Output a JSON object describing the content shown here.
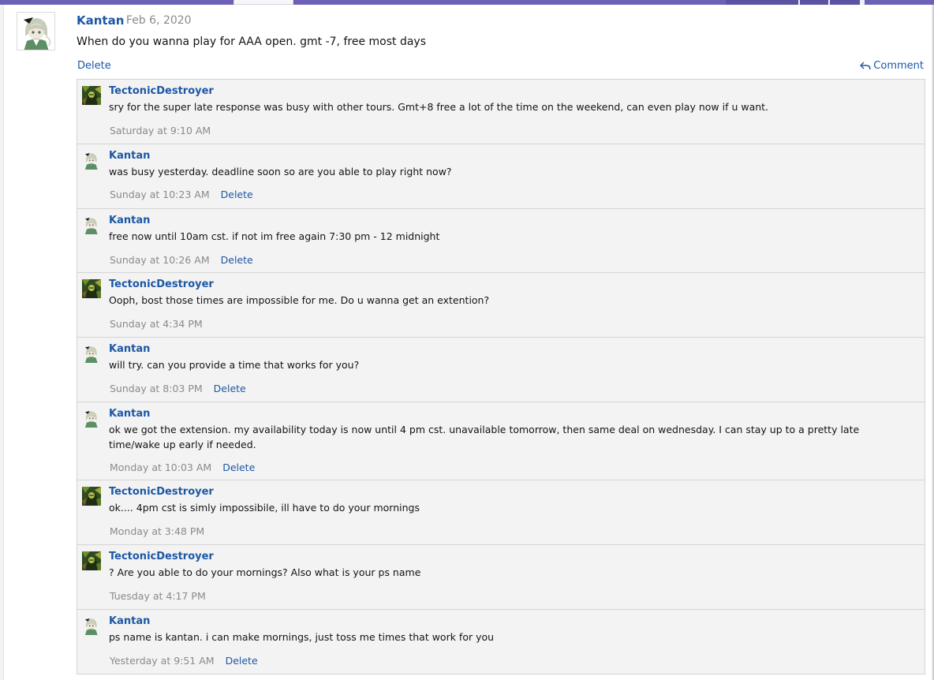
{
  "post": {
    "author": "Kantan",
    "date": "· Feb 6, 2020",
    "text": "When do you wanna play for AAA open. gmt -7, free most days",
    "delete_label": "Delete",
    "comment_label": "Comment",
    "avatar_icon": "kantan-avatar-icon",
    "comment_icon": "reply-arrow-icon"
  },
  "colors": {
    "accent": "#6b62b5",
    "link": "#1c57a5",
    "muted": "#8a8a8a"
  },
  "comments": [
    {
      "author": "TectonicDestroyer",
      "avatar_icon": "tectonic-avatar-icon",
      "text": "sry for the super late response was busy with other tours. Gmt+8 free a lot of the time on the weekend, can even play now if u want.",
      "time": "Saturday at 9:10 AM",
      "delete": ""
    },
    {
      "author": "Kantan",
      "avatar_icon": "kantan-avatar-icon",
      "text": "was busy yesterday. deadline soon so are you able to play right now?",
      "time": "Sunday at 10:23 AM",
      "delete": "Delete"
    },
    {
      "author": "Kantan",
      "avatar_icon": "kantan-avatar-icon",
      "text": "free now until 10am cst. if not im free again 7:30 pm - 12 midnight",
      "time": "Sunday at 10:26 AM",
      "delete": "Delete"
    },
    {
      "author": "TectonicDestroyer",
      "avatar_icon": "tectonic-avatar-icon",
      "text": "Ooph, bost those times are impossible for me. Do u wanna get an extention?",
      "time": "Sunday at 4:34 PM",
      "delete": ""
    },
    {
      "author": "Kantan",
      "avatar_icon": "kantan-avatar-icon",
      "text": "will try. can you provide a time that works for you?",
      "time": "Sunday at 8:03 PM",
      "delete": "Delete"
    },
    {
      "author": "Kantan",
      "avatar_icon": "kantan-avatar-icon",
      "text": "ok we got the extension. my availability today is now until 4 pm cst. unavailable tomorrow, then same deal on wednesday. I can stay up to a pretty late time/wake up early if needed.",
      "time": "Monday at 10:03 AM",
      "delete": "Delete"
    },
    {
      "author": "TectonicDestroyer",
      "avatar_icon": "tectonic-avatar-icon",
      "text": "ok.... 4pm cst is simly impossibile, ill have to do your mornings",
      "time": "Monday at 3:48 PM",
      "delete": ""
    },
    {
      "author": "TectonicDestroyer",
      "avatar_icon": "tectonic-avatar-icon",
      "text": "? Are you able to do your mornings? Also what is your ps name",
      "time": "Tuesday at 4:17 PM",
      "delete": ""
    },
    {
      "author": "Kantan",
      "avatar_icon": "kantan-avatar-icon",
      "text": "ps name is kantan. i can make mornings, just toss me times that work for you",
      "time": "Yesterday at 9:51 AM",
      "delete": "Delete"
    }
  ]
}
